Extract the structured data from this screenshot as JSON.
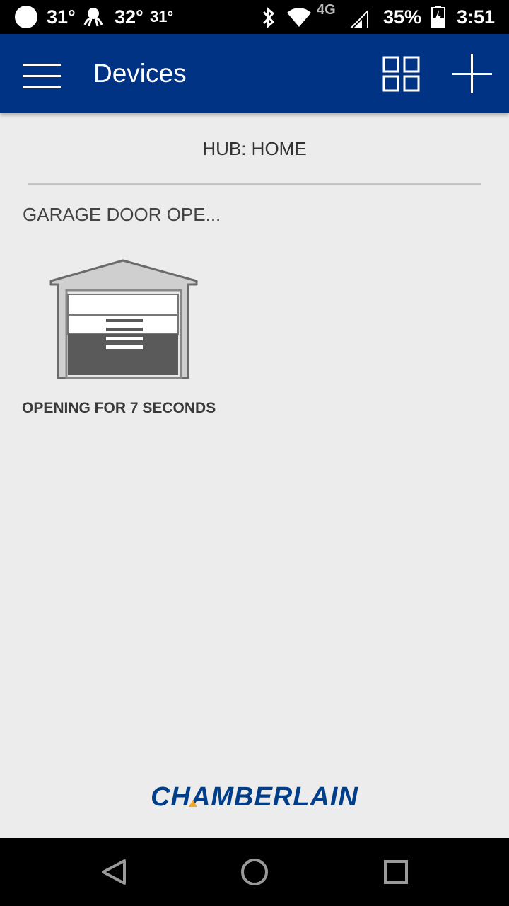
{
  "status_bar": {
    "temp_1": "31°",
    "temp_2": "32°",
    "temp_3": "31°",
    "network": "4G",
    "battery": "35%",
    "time": "3:51"
  },
  "app_bar": {
    "title": "Devices"
  },
  "hub": {
    "label": "HUB: HOME"
  },
  "device": {
    "name": "GARAGE DOOR OPE...",
    "status": "OPENING FOR 7 SECONDS"
  },
  "brand": {
    "name": "CHAMBERLAIN"
  },
  "colors": {
    "app_bar": "#003383",
    "background": "#ececec",
    "brand_blue": "#003e8a",
    "brand_accent": "#f5a623"
  },
  "icons": {
    "menu": "hamburger-menu-icon",
    "grid": "grid-view-icon",
    "add": "add-icon",
    "back": "back-triangle-icon",
    "home": "home-circle-icon",
    "recents": "recents-square-icon"
  }
}
